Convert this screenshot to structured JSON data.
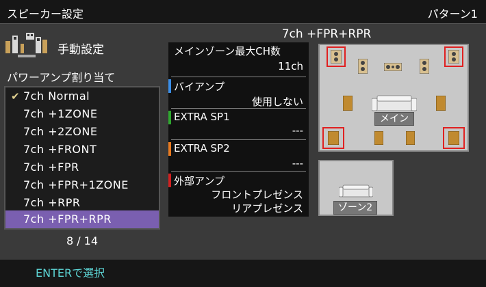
{
  "header": {
    "title": "スピーカー設定",
    "pattern": "パターン1"
  },
  "left": {
    "mode_label": "手動設定",
    "assign_label": "パワーアンプ割り当て",
    "items": [
      "7ch Normal",
      "7ch +1ZONE",
      "7ch +2ZONE",
      "7ch +FRONT",
      "7ch +FPR",
      "7ch +FPR+1ZONE",
      "7ch +RPR",
      "7ch +FPR+RPR"
    ],
    "page": "8 / 14"
  },
  "main": {
    "title": "7ch +FPR+RPR",
    "info": {
      "max_ch_label": "メインゾーン最大CH数",
      "max_ch_value": "11ch",
      "biamp_label": "バイアンプ",
      "biamp_value": "使用しない",
      "extra1_label": "EXTRA SP1",
      "extra1_value": "---",
      "extra2_label": "EXTRA SP2",
      "extra2_value": "---",
      "ext_amp_label": "外部アンプ",
      "ext_amp_value1": "フロントプレゼンス",
      "ext_amp_value2": "リアプレゼンス"
    },
    "colors": {
      "biamp": "#3a8ee8",
      "extra1": "#2fa82f",
      "extra2": "#e87a20",
      "ext_amp": "#d02020"
    },
    "room_main_label": "メイン",
    "room_zone2_label": "ゾーン2"
  },
  "footer": {
    "enter": "ENTERで選択"
  }
}
